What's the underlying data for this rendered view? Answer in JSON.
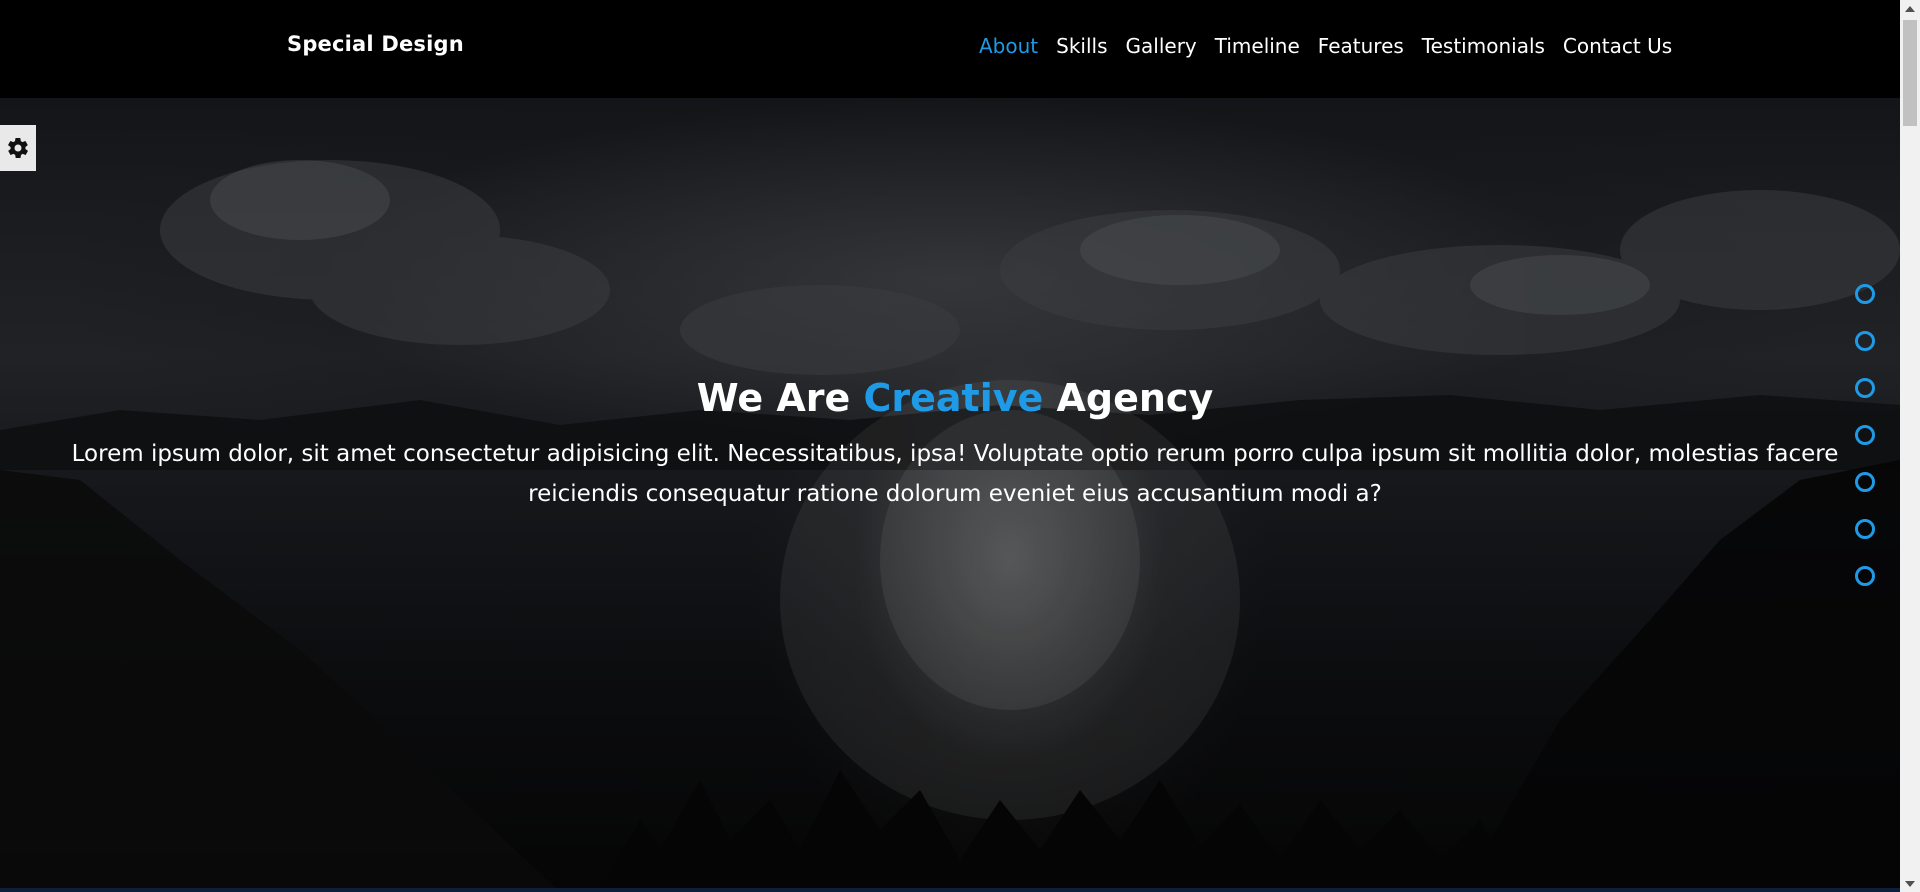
{
  "header": {
    "logo": "Special Design",
    "nav": [
      {
        "label": "About",
        "active": true
      },
      {
        "label": "Skills",
        "active": false
      },
      {
        "label": "Gallery",
        "active": false
      },
      {
        "label": "Timeline",
        "active": false
      },
      {
        "label": "Features",
        "active": false
      },
      {
        "label": "Testimonials",
        "active": false
      },
      {
        "label": "Contact Us",
        "active": false
      }
    ]
  },
  "settings": {
    "icon": "gear-icon"
  },
  "hero": {
    "title_before": "We Are ",
    "title_accent": "Creative",
    "title_after": " Agency",
    "text": "Lorem ipsum dolor, sit amet consectetur adipisicing elit. Necessitatibus, ipsa! Voluptate optio rerum porro culpa ipsum sit mollitia dolor, molestias facere reiciendis consequatur ratione dolorum eveniet eius accusantium modi a?"
  },
  "bullets_count": 7,
  "colors": {
    "accent": "#1e9ae6",
    "header_bg": "#000000",
    "text": "#ffffff"
  }
}
